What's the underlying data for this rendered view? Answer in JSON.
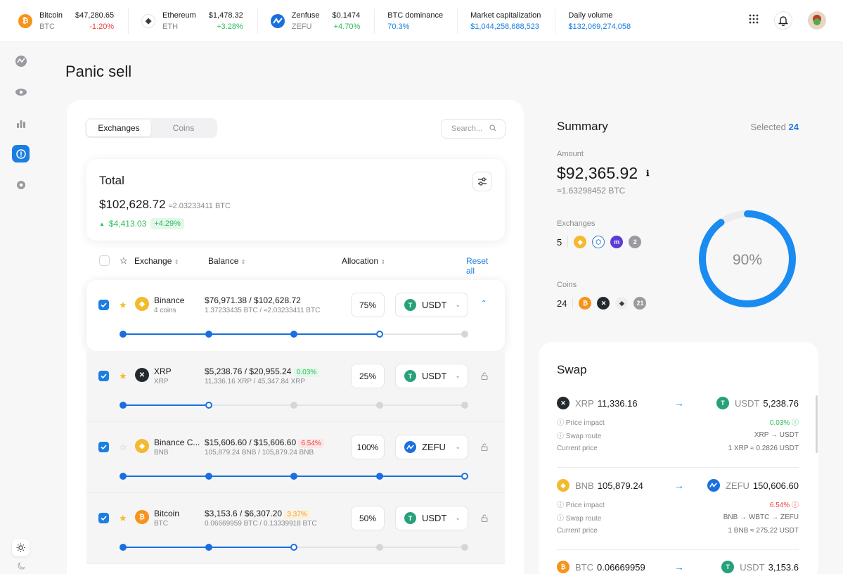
{
  "ticker": [
    {
      "name": "Bitcoin",
      "symbol": "BTC",
      "price": "$47,280.65",
      "change": "-1.20%",
      "dir": "neg",
      "icon": "bitcoin-icon",
      "color": "#f7931a",
      "glyph": "₿"
    },
    {
      "name": "Ethereum",
      "symbol": "ETH",
      "price": "$1,478.32",
      "change": "+3.28%",
      "dir": "pos",
      "icon": "ethereum-icon",
      "color": "#ffffff",
      "glyph": "◆"
    },
    {
      "name": "Zenfuse",
      "symbol": "ZEFU",
      "price": "$0.1474",
      "change": "+4.70%",
      "dir": "pos",
      "icon": "zenfuse-icon",
      "color": "#1a6fe0",
      "glyph": "Z"
    }
  ],
  "stats": [
    {
      "label": "BTC dominance",
      "value": "70.3%"
    },
    {
      "label": "Market capitalization",
      "value": "$1,044,258,688,523"
    },
    {
      "label": "Daily volume",
      "value": "$132,069,274,058"
    }
  ],
  "page": {
    "title": "Panic sell"
  },
  "tabs": [
    "Exchanges",
    "Coins"
  ],
  "search": {
    "placeholder": "Search..."
  },
  "total": {
    "label": "Total",
    "amount": "$102,628.72",
    "btc": "≈2.03233411 BTC",
    "change": "$4,413.03",
    "change_pct": "+4.29%"
  },
  "table": {
    "col_exchange": "Exchange",
    "col_balance": "Balance",
    "col_allocation": "Allocation",
    "reset": "Reset all"
  },
  "rows": [
    {
      "name": "Binance",
      "sub": "4 coins",
      "balance": "$76,971.38 / $102,628.72",
      "balance_sub": "1.37233435 BTC / ≈2.03233411 BTC",
      "badge": "",
      "pct": "75%",
      "coin": "USDT",
      "starred": true,
      "checked": true,
      "icon": "binance-icon",
      "color": "#f3ba2f",
      "level": 0.75
    },
    {
      "name": "XRP",
      "sub": "XRP",
      "balance": "$5,238.76 / $20,955.24",
      "balance_sub": "11,336.16 XRP / 45,347.84 XRP",
      "badge": "0.03%",
      "badge_type": "g",
      "pct": "25%",
      "coin": "USDT",
      "starred": true,
      "checked": true,
      "icon": "xrp-icon",
      "color": "#23292f",
      "level": 0.25
    },
    {
      "name": "Binance C...",
      "sub": "BNB",
      "balance": "$15,606.60 / $15,606.60",
      "balance_sub": "105,879.24 BNB / 105,879.24 BNB",
      "badge": "6.54%",
      "badge_type": "r",
      "pct": "100%",
      "coin": "ZEFU",
      "starred": false,
      "checked": true,
      "icon": "bnb-icon",
      "color": "#f3ba2f",
      "level": 1.0
    },
    {
      "name": "Bitcoin",
      "sub": "BTC",
      "balance": "$3,153.6 / $6,307.20",
      "balance_sub": "0.06669959 BTC / 0.13339918 BTC",
      "badge": "3.37%",
      "badge_type": "y",
      "pct": "50%",
      "coin": "USDT",
      "starred": true,
      "checked": true,
      "icon": "bitcoin-icon",
      "color": "#f7931a",
      "level": 0.5
    }
  ],
  "summary": {
    "title": "Summary",
    "selected_label": "Selected",
    "selected_count": "24",
    "amount_label": "Amount",
    "amount": "$92,365.92",
    "amount_btc": "≈1.63298452 BTC",
    "exchanges_label": "Exchanges",
    "exchanges_count": "5",
    "exchanges_more": "2",
    "coins_label": "Coins",
    "coins_count": "24",
    "coins_more": "21",
    "progress": "90%",
    "progress_value": 0.9
  },
  "swap": {
    "title": "Swap",
    "price_impact": "Price impact",
    "swap_route": "Swap route",
    "current_price": "Current price",
    "items": [
      {
        "from": "XRP",
        "from_amt": "11,336.16",
        "to": "USDT",
        "to_amt": "5,238.76",
        "impact": "0.03%",
        "impact_dir": "pos",
        "route": "XRP → USDT",
        "price": "1 XRP ≈ 0.2826 USDT"
      },
      {
        "from": "BNB",
        "from_amt": "105,879.24",
        "to": "ZEFU",
        "to_amt": "150,606.60",
        "impact": "6.54%",
        "impact_dir": "neg",
        "route": "BNB → WBTC → ZEFU",
        "price": "1 BNB ≈ 275.22 USDT"
      },
      {
        "from": "BTC",
        "from_amt": "0.06669959",
        "to": "USDT",
        "to_amt": "3,153.6"
      }
    ]
  }
}
